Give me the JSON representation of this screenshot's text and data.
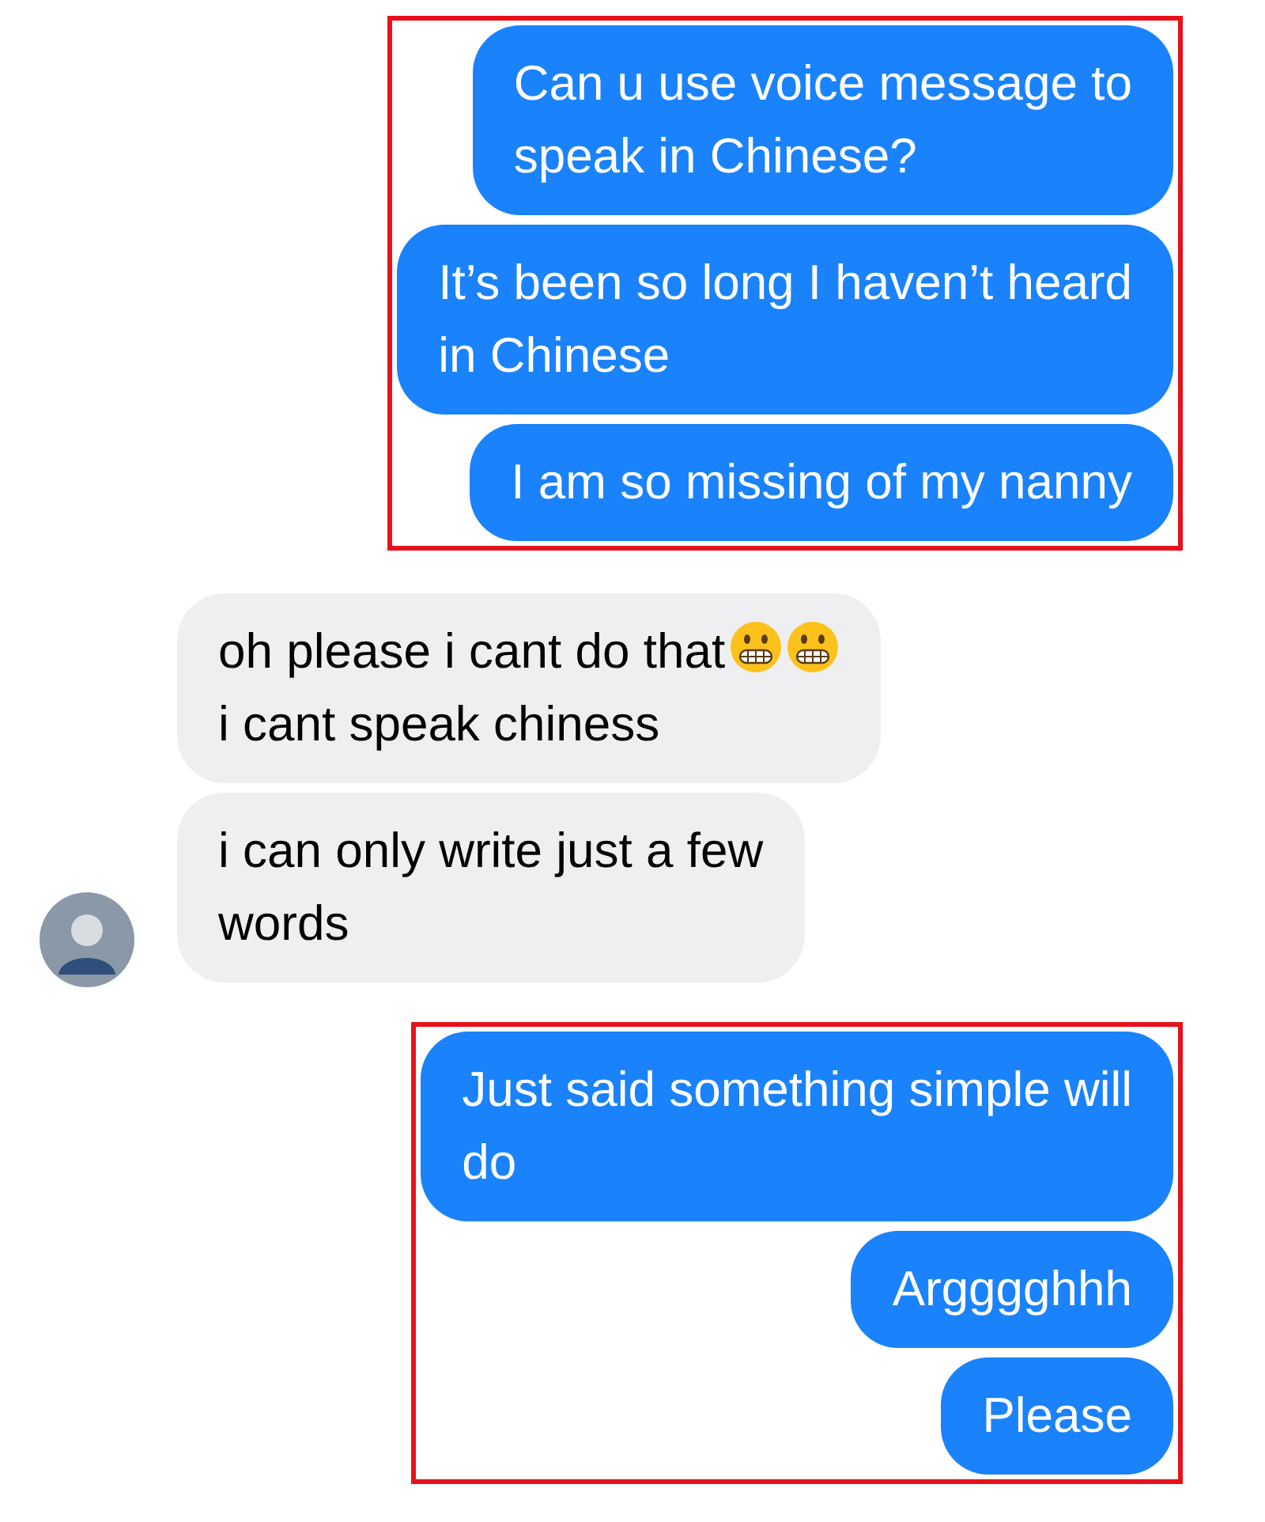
{
  "groups": [
    {
      "kind": "sent",
      "highlighted": true,
      "messages": [
        {
          "text": "Can u use voice message to\nspeak in Chinese?"
        },
        {
          "text": "It’s been so long I haven’t heard\nin Chinese"
        },
        {
          "text": "I am so missing of my nanny"
        }
      ]
    },
    {
      "kind": "received",
      "highlighted": false,
      "messages": [
        {
          "text": "oh please i cant do that",
          "emojis": [
            {
              "kind": "grimace"
            },
            {
              "kind": "grimace"
            }
          ],
          "text2": "i cant speak chiness"
        },
        {
          "text": "i can only write just a few\nwords"
        }
      ]
    },
    {
      "kind": "sent",
      "highlighted": true,
      "messages": [
        {
          "text": "Just said something simple will\ndo"
        },
        {
          "text": "Argggghhh"
        },
        {
          "text": "Please"
        }
      ]
    }
  ]
}
